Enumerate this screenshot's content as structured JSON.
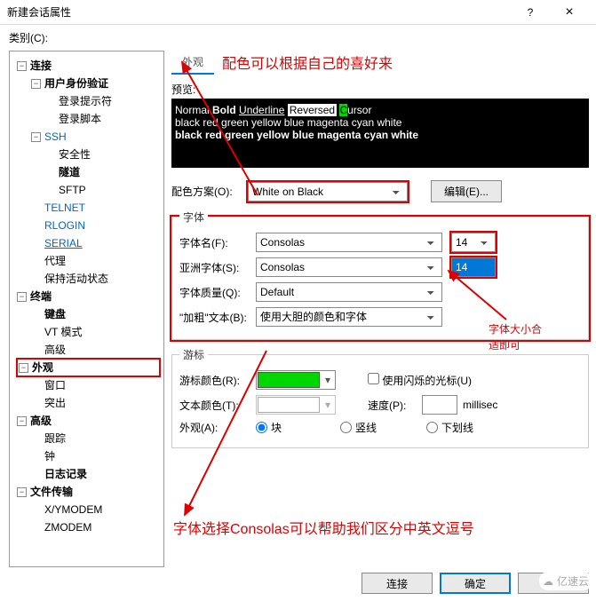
{
  "window": {
    "title": "新建会话属性",
    "help": "?",
    "close": "×"
  },
  "category_label": "类别(C):",
  "tree": {
    "connection": "连接",
    "auth": "用户身份验证",
    "login_prompt": "登录提示符",
    "login_script": "登录脚本",
    "ssh": "SSH",
    "security": "安全性",
    "tunnel": "隧道",
    "sftp": "SFTP",
    "telnet": "TELNET",
    "rlogin": "RLOGIN",
    "serial": "SERIAL",
    "proxy": "代理",
    "keepalive": "保持活动状态",
    "terminal": "终端",
    "keyboard": "键盘",
    "vtmode": "VT 模式",
    "advanced1": "高级",
    "appearance": "外观",
    "window": "窗口",
    "highlight": "突出",
    "advanced2": "高级",
    "trace": "跟踪",
    "bell": "钟",
    "logging": "日志记录",
    "filetransfer": "文件传输",
    "xymodem": "X/YMODEM",
    "zmodem": "ZMODEM"
  },
  "tab": "外观",
  "preview_label": "预览:",
  "preview": {
    "normal": "Normal",
    "bold": "Bold",
    "underline": "Underline",
    "reversed": "Reversed",
    "cursor_c": "C",
    "cursor_rest": "ursor",
    "colors": "black red green yellow blue magenta cyan white"
  },
  "scheme": {
    "label": "配色方案(O):",
    "value": "White on Black",
    "edit": "编辑(E)..."
  },
  "font_group": "字体",
  "font_name": {
    "label": "字体名(F):",
    "value": "Consolas",
    "size": "14"
  },
  "asia_font": {
    "label": "亚洲字体(S):",
    "value": "Consolas",
    "size": "14"
  },
  "quality": {
    "label": "字体质量(Q):",
    "value": "Default"
  },
  "boldtext": {
    "label": "\"加粗\"文本(B):",
    "value": "使用大胆的颜色和字体"
  },
  "cursor_group": "游标",
  "cursor_color": {
    "label": "游标颜色(R):",
    "blink": "使用闪烁的光标(U)"
  },
  "text_color": {
    "label": "文本颜色(T):",
    "speed": "速度(P):",
    "unit": "millisec"
  },
  "cursor_shape": {
    "label": "外观(A):",
    "block": "块",
    "vline": "竖线",
    "uline": "下划线"
  },
  "footer": {
    "connect": "连接",
    "ok": "确定",
    "cancel": "取消"
  },
  "annotations": {
    "top": "配色可以根据自己的喜好来",
    "right1": "字体大小合",
    "right2": "适即可",
    "bottom": "字体选择Consolas可以帮助我们区分中英文逗号"
  },
  "watermark": "亿速云"
}
